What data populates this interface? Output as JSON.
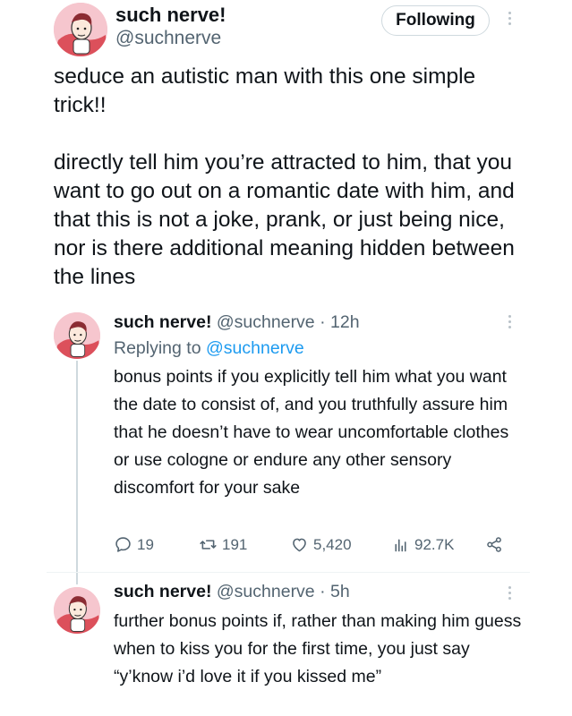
{
  "post": {
    "display_name": "such nerve!",
    "handle": "@suchnerve",
    "follow_label": "Following",
    "paragraphs": [
      "seduce an autistic man with this one simple trick!!",
      "directly tell him you’re attracted to him, that you want to go out on a romantic date with him, and that this is not a joke, prank, or just being nice, nor is there additional meaning hidden between the lines"
    ]
  },
  "replies": [
    {
      "display_name": "such nerve!",
      "handle": "@suchnerve",
      "separator": "·",
      "time": "12h",
      "replying_prefix": "Replying to",
      "replying_handle": "@suchnerve",
      "text": "bonus points if you explicitly tell him what you want the date to consist of, and you truthfully assure him that he doesn’t have to wear uncomfortable clothes or use cologne or endure any other sensory discomfort for your sake",
      "stats": {
        "replies": "19",
        "reposts": "191",
        "likes": "5,420",
        "views": "92.7K"
      }
    },
    {
      "display_name": "such nerve!",
      "handle": "@suchnerve",
      "separator": "·",
      "time": "5h",
      "text": "further bonus points if, rather than making him guess when to kiss you for the first time, you just say “y’know i’d love it if you kissed me”"
    }
  ],
  "colors": {
    "text": "#0f1419",
    "secondary": "#536471",
    "mention": "#1d9bf0",
    "avatar_bg": "#f6c6ce",
    "avatar_stripe": "#d9434f"
  },
  "icons": {
    "reply": "speech-bubble-icon",
    "repost": "repost-arrows-icon",
    "like": "heart-icon",
    "views": "bar-chart-icon",
    "share": "share-icon",
    "more": "vertical-dots-icon"
  }
}
